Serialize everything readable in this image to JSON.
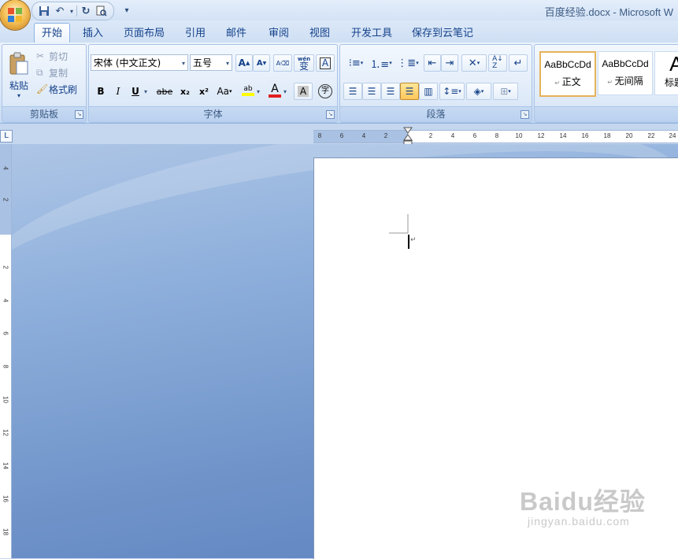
{
  "window": {
    "title": "百度经验.docx - Microsoft W"
  },
  "quick_access": {
    "icons": [
      "save-icon",
      "undo-icon",
      "redo-icon",
      "print-preview-icon",
      "customize-dropdown-icon"
    ]
  },
  "tabs": [
    "开始",
    "插入",
    "页面布局",
    "引用",
    "邮件",
    "审阅",
    "视图",
    "开发工具",
    "保存到云笔记"
  ],
  "clipboard": {
    "label": "剪贴板",
    "paste": "粘贴",
    "cut": "剪切",
    "copy": "复制",
    "format_painter": "格式刷"
  },
  "font": {
    "label": "字体",
    "font_name": "宋体 (中文正文)",
    "font_size": "五号",
    "grow": "A",
    "shrink": "A",
    "bold": "B",
    "italic": "I",
    "underline": "U",
    "strike": "abe",
    "subscript": "x₂",
    "superscript": "x²",
    "change_case": "Aa",
    "highlight": "ab",
    "font_color": "A",
    "char_shading": "A",
    "enclose": "字",
    "phonetic": "wén",
    "phonetic_char": "变"
  },
  "paragraph": {
    "label": "段落"
  },
  "styles": {
    "items": [
      {
        "sample": "AaBbCcDd",
        "name": "正文"
      },
      {
        "sample": "AaBbCcDd",
        "name": "无间隔"
      },
      {
        "sample": "Aa",
        "name": "标题"
      }
    ]
  },
  "ruler": {
    "corner": "L",
    "h_labels": [
      "8",
      "6",
      "4",
      "2",
      "2",
      "4",
      "6",
      "8",
      "10",
      "12",
      "14",
      "16",
      "18",
      "20",
      "22",
      "24"
    ],
    "v_labels": [
      "4",
      "2",
      "2",
      "4",
      "6",
      "8",
      "10",
      "12",
      "14",
      "16",
      "18"
    ]
  },
  "watermark": {
    "brand": "Baidu经验",
    "url": "jingyan.baidu.com"
  },
  "colors": {
    "accent": "#15428b",
    "font_color_bar": "#e02020",
    "highlight_bar": "#ffff00"
  }
}
